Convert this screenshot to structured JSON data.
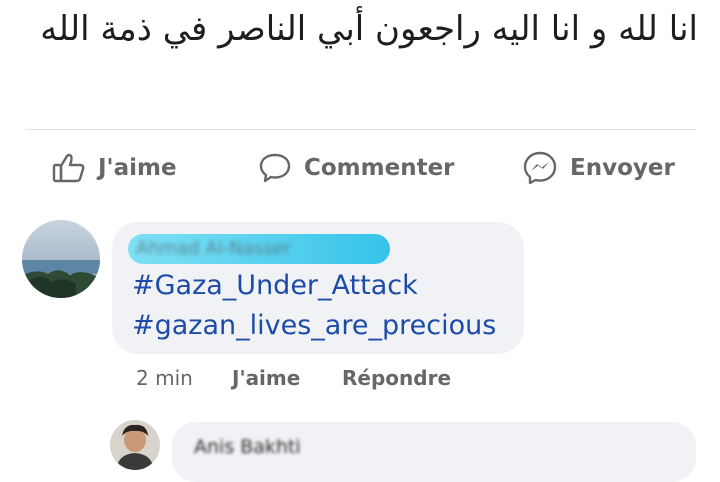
{
  "post": {
    "text": "انا لله و انا اليه راجعون أبي الناصر في ذمة الله"
  },
  "actions": {
    "like_label": "J'aime",
    "comment_label": "Commenter",
    "send_label": "Envoyer"
  },
  "comments": [
    {
      "author": "Ahmad Al-Nasser",
      "lines": [
        "#Gaza_Under_Attack",
        "#gazan_lives_are_precious"
      ],
      "time": "2 min",
      "like_label": "J'aime",
      "reply_label": "Répondre"
    },
    {
      "author": "Anis Bakhti"
    }
  ],
  "colors": {
    "hashtag": "#1d4ba8",
    "muted": "#65676b",
    "bubble": "#f0f2f5",
    "name_highlight": "#4fd0ef"
  }
}
